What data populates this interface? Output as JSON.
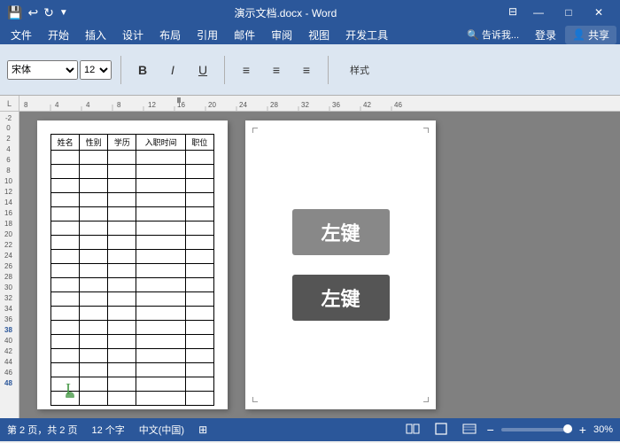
{
  "titlebar": {
    "title": "演示文档.docx - Word",
    "save_icon": "💾",
    "undo_icon": "↩",
    "redo_icon": "↻",
    "more_icon": "▼",
    "minimize": "—",
    "restore": "□",
    "close": "✕",
    "collapse": "⊟"
  },
  "menu": {
    "items": [
      "文件",
      "开始",
      "插入",
      "设计",
      "布局",
      "引用",
      "邮件",
      "审阅",
      "视图",
      "开发工具"
    ]
  },
  "menu_right": {
    "tell_me": "🔍 告诉我...",
    "login": "登录",
    "share": "共享"
  },
  "ruler": {
    "corner": "L",
    "marks": [
      "8",
      "4",
      "4",
      "8",
      "12",
      "16",
      "20",
      "24",
      "28",
      "32",
      "36",
      "42",
      "46"
    ]
  },
  "table": {
    "headers": [
      "姓名",
      "性别",
      "学历",
      "入职时间",
      "职位"
    ],
    "rows": 18
  },
  "page2": {
    "btn1": "左键",
    "btn2": "左键"
  },
  "statusbar": {
    "page_info": "第 2 页，共 2 页",
    "word_count": "12 个字",
    "lang": "中文(中国)",
    "zoom": "30%"
  },
  "vruler_marks": [
    "-2",
    "0",
    "2",
    "4",
    "6",
    "8",
    "10",
    "12",
    "14",
    "16",
    "18",
    "20",
    "22",
    "24",
    "26",
    "28",
    "30",
    "32",
    "34",
    "36",
    "38",
    "40",
    "42",
    "44",
    "46",
    "48"
  ]
}
